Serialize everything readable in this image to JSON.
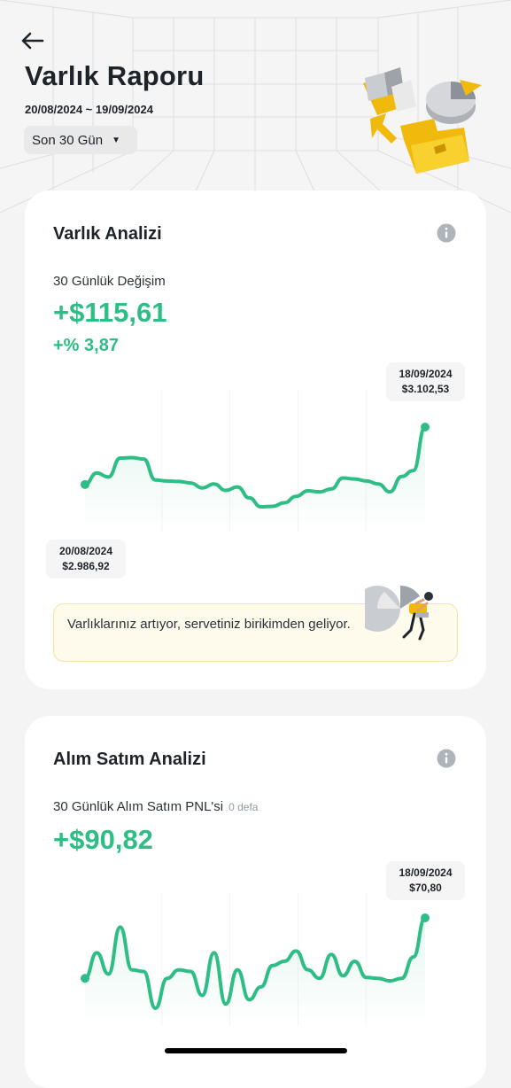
{
  "header": {
    "title": "Varlık Raporu",
    "date_range": "20/08/2024 ~ 19/09/2024",
    "range_select": "Son 30 Gün"
  },
  "asset_analysis": {
    "title": "Varlık Analizi",
    "label": "30 Günlük Değişim",
    "value": "+$115,61",
    "percent": "+% 3,87",
    "start_tag": {
      "date": "20/08/2024",
      "value": "$2.986,92"
    },
    "end_tag": {
      "date": "18/09/2024",
      "value": "$3.102,53"
    },
    "message": "Varlıklarınız artıyor, servetiniz birikimden geliyor."
  },
  "trade_analysis": {
    "title": "Alım Satım Analizi",
    "label": "30 Günlük Alım Satım PNL'si",
    "count": "0 defa",
    "value": "+$90,82",
    "end_tag": {
      "date": "18/09/2024",
      "value": "$70,80"
    }
  },
  "colors": {
    "positive": "#2ebd85",
    "brand": "#f0b90b"
  },
  "chart_data": [
    {
      "type": "line",
      "series": [
        {
          "values": [
            2986.92,
            3010,
            3002,
            3040,
            3041,
            3038,
            2996,
            2994,
            2993,
            2990,
            2980,
            2988,
            2975,
            2982,
            2960,
            2942,
            2943,
            2950,
            2963,
            2974,
            2972,
            2978,
            3000,
            2998,
            2994,
            2988,
            2972,
            3003,
            3015,
            3102.53
          ]
        }
      ],
      "x": [
        "20/08/2024",
        "",
        "",
        "",
        "",
        "",
        "",
        "",
        "",
        "",
        "",
        "",
        "",
        "",
        "",
        "",
        "",
        "",
        "",
        "",
        "",
        "",
        "",
        "",
        "",
        "",
        "",
        "",
        "",
        "18/09/2024"
      ],
      "xlabel": "",
      "ylabel": ""
    },
    {
      "type": "line",
      "series": [
        {
          "values": [
            0,
            30,
            5,
            60,
            10,
            8,
            -35,
            0,
            10,
            8,
            -20,
            30,
            -30,
            10,
            -25,
            -10,
            15,
            20,
            32,
            10,
            0,
            28,
            3,
            20,
            1,
            0,
            -3,
            0,
            25,
            70.8
          ]
        }
      ],
      "x": [
        "",
        "",
        "",
        "",
        "",
        "",
        "",
        "",
        "",
        "",
        "",
        "",
        "",
        "",
        "",
        "",
        "",
        "",
        "",
        "",
        "",
        "",
        "",
        "",
        "",
        "",
        "",
        "",
        "",
        "18/09/2024"
      ],
      "xlabel": "",
      "ylabel": ""
    }
  ]
}
